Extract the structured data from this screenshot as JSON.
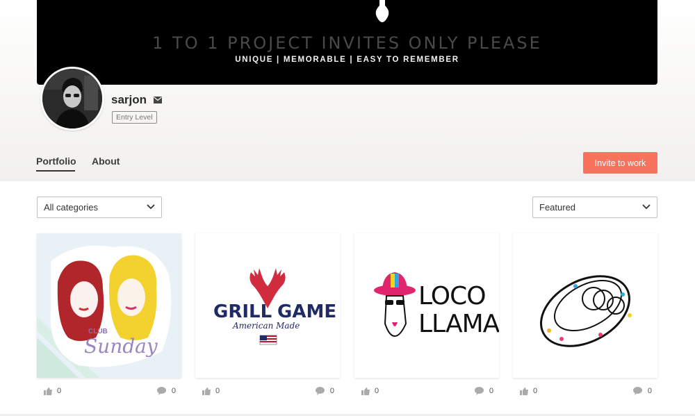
{
  "banner": {
    "title": "1 TO 1 PROJECT INVITES ONLY PLEASE",
    "subtitle": "UNIQUE | MEMORABLE | EASY TO REMEMBER"
  },
  "profile": {
    "username": "sarjon",
    "level": "Entry Level"
  },
  "tabs": [
    {
      "label": "Portfolio",
      "active": true
    },
    {
      "label": "About",
      "active": false
    }
  ],
  "invite_button": "Invite to work",
  "filters": {
    "category": "All categories",
    "sort": "Featured"
  },
  "portfolio": [
    {
      "title_lines": [
        "CLUB",
        "Sunday"
      ],
      "likes": "0",
      "comments": "0"
    },
    {
      "title_lines": [
        "GRILL",
        "GAME",
        "American Made"
      ],
      "likes": "0",
      "comments": "0"
    },
    {
      "title_lines": [
        "LOCO",
        "LLAMA"
      ],
      "likes": "0",
      "comments": "0"
    },
    {
      "title_lines": [],
      "likes": "0",
      "comments": "0"
    }
  ],
  "colors": {
    "accent": "#f7735e",
    "banner_bg": "#000000"
  }
}
